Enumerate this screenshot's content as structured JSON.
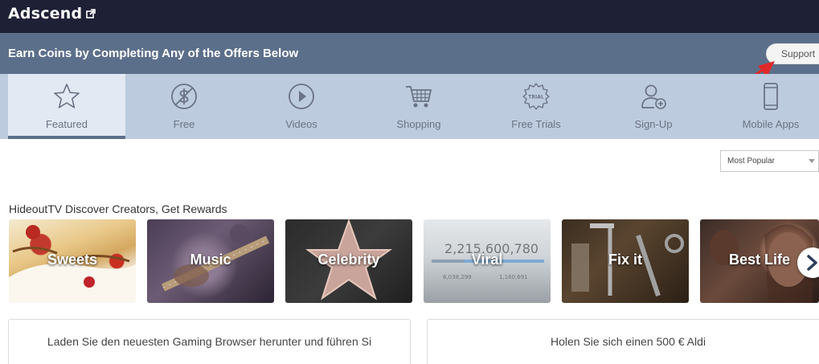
{
  "topbar": {
    "brand": "Adscend",
    "brand_icon": "external-link-icon"
  },
  "banner": {
    "text": "Earn Coins by Completing Any of the Offers Below",
    "support_label": "Support"
  },
  "tabs": [
    {
      "label": "Featured",
      "icon": "star-icon",
      "active": true
    },
    {
      "label": "Free",
      "icon": "no-dollar-icon",
      "active": false
    },
    {
      "label": "Videos",
      "icon": "play-circle-icon",
      "active": false
    },
    {
      "label": "Shopping",
      "icon": "cart-icon",
      "active": false
    },
    {
      "label": "Free Trials",
      "icon": "trial-badge-icon",
      "active": false
    },
    {
      "label": "Sign-Up",
      "icon": "add-user-icon",
      "active": false
    },
    {
      "label": "Mobile Apps",
      "icon": "mobile-icon",
      "active": false
    }
  ],
  "trial_badge_text": "TRIAL",
  "sort": {
    "selected": "Most Popular"
  },
  "section": {
    "title": "HideoutTV Discover Creators, Get Rewards"
  },
  "categories": [
    {
      "label": "Sweets"
    },
    {
      "label": "Music"
    },
    {
      "label": "Celebrity"
    },
    {
      "label": "Viral"
    },
    {
      "label": "Fix it"
    },
    {
      "label": "Best Life"
    }
  ],
  "viral_counter": {
    "views": "2,215,600,780",
    "likes": "6,038,299",
    "dislikes": "1,160,691"
  },
  "offers": [
    {
      "title": "Laden Sie den neuesten Gaming Browser herunter und führen Si"
    },
    {
      "title": "Holen Sie sich einen 500 € Aldi"
    }
  ],
  "colors": {
    "topbar": "#1e2035",
    "banner": "#5c6f8a",
    "tabs": "#bccbdd",
    "active_tab": "#e2e9f2",
    "annotation_arrow": "#e02a2a"
  }
}
